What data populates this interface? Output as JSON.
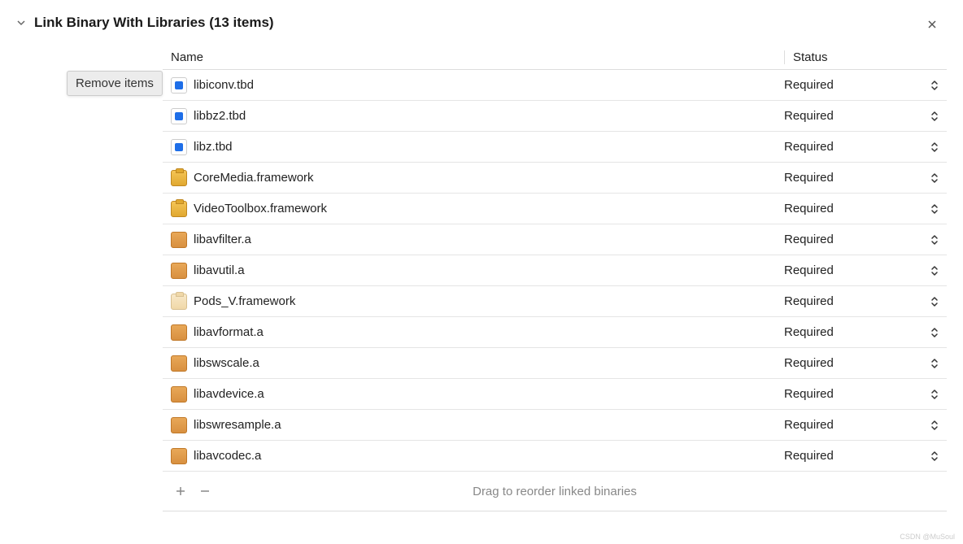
{
  "section": {
    "title": "Link Binary With Libraries (13 items)",
    "tooltip": "Remove items"
  },
  "columns": {
    "name": "Name",
    "status": "Status"
  },
  "libraries": [
    {
      "name": "libiconv.tbd",
      "status": "Required",
      "iconType": "tbd"
    },
    {
      "name": "libbz2.tbd",
      "status": "Required",
      "iconType": "tbd"
    },
    {
      "name": "libz.tbd",
      "status": "Required",
      "iconType": "tbd"
    },
    {
      "name": "CoreMedia.framework",
      "status": "Required",
      "iconType": "framework"
    },
    {
      "name": "VideoToolbox.framework",
      "status": "Required",
      "iconType": "framework"
    },
    {
      "name": "libavfilter.a",
      "status": "Required",
      "iconType": "archive"
    },
    {
      "name": "libavutil.a",
      "status": "Required",
      "iconType": "archive"
    },
    {
      "name": "Pods_V.framework",
      "status": "Required",
      "iconType": "framework-light"
    },
    {
      "name": "libavformat.a",
      "status": "Required",
      "iconType": "archive"
    },
    {
      "name": "libswscale.a",
      "status": "Required",
      "iconType": "archive"
    },
    {
      "name": "libavdevice.a",
      "status": "Required",
      "iconType": "archive"
    },
    {
      "name": "libswresample.a",
      "status": "Required",
      "iconType": "archive"
    },
    {
      "name": "libavcodec.a",
      "status": "Required",
      "iconType": "archive"
    }
  ],
  "footer": {
    "hint": "Drag to reorder linked binaries"
  },
  "watermark": "CSDN @MuSoul"
}
